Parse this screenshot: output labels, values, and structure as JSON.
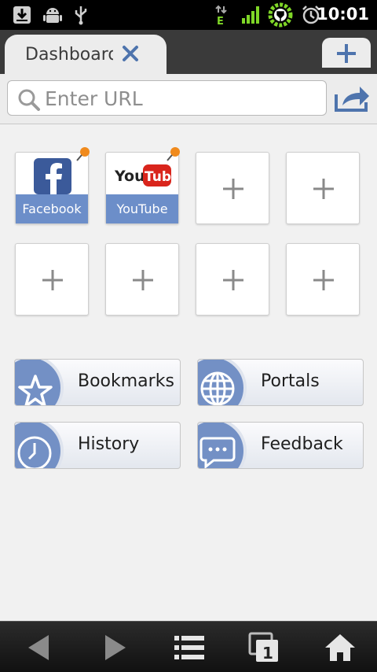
{
  "status_bar": {
    "time": "10:01",
    "icons": [
      "download-icon",
      "android-icon",
      "usb-icon",
      "data-arrows-icon",
      "signal-icon",
      "battery-charging-icon",
      "alarm-icon"
    ],
    "network_label": "E"
  },
  "tab_bar": {
    "tabs": [
      {
        "title": "Dashboard",
        "close_icon": "close-icon"
      }
    ],
    "new_tab_icon": "plus-icon"
  },
  "url_bar": {
    "placeholder": "Enter URL",
    "search_icon": "search-icon",
    "share_icon": "share-icon"
  },
  "speed_dial": {
    "tiles": [
      {
        "label": "Facebook",
        "pinned": true
      },
      {
        "label": "YouTube",
        "pinned": true
      },
      {
        "label": "",
        "empty": true
      },
      {
        "label": "",
        "empty": true
      },
      {
        "label": "",
        "empty": true
      },
      {
        "label": "",
        "empty": true
      },
      {
        "label": "",
        "empty": true
      },
      {
        "label": "",
        "empty": true
      }
    ],
    "youtube_logo": {
      "you": "You",
      "tube": "Tube"
    }
  },
  "nav_buttons": [
    {
      "label": "Bookmarks",
      "icon": "star-icon"
    },
    {
      "label": "Portals",
      "icon": "globe-icon"
    },
    {
      "label": "History",
      "icon": "clock-icon"
    },
    {
      "label": "Feedback",
      "icon": "chat-bubble-icon"
    }
  ],
  "toolbar": {
    "buttons": [
      "back-arrow-icon",
      "forward-arrow-icon",
      "menu-list-icon",
      "tabs-icon",
      "home-icon"
    ],
    "tab_count": "1"
  },
  "colors": {
    "tile_label_bg": "#6c8ec9",
    "nav_circle": "#7390c5",
    "facebook_blue": "#3b5a9a",
    "youtube_red": "#d9251c"
  }
}
